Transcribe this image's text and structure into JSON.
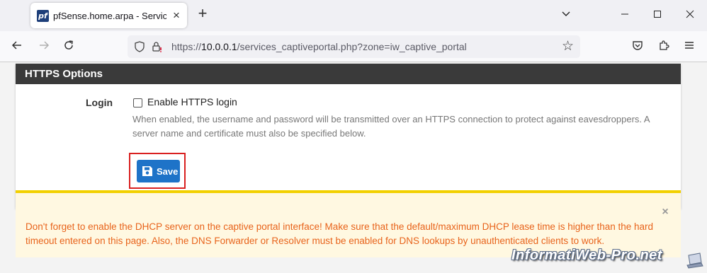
{
  "browser": {
    "tab_title": "pfSense.home.arpa - Services: Captive Portal",
    "favicon_text": "pf",
    "url_prefix": "https://",
    "url_host": "10.0.0.1",
    "url_path": "/services_captiveportal.php?zone=iw_captive_portal"
  },
  "panel": {
    "title": "HTTPS Options",
    "login_label": "Login",
    "checkbox_label": "Enable HTTPS login",
    "checkbox_checked": false,
    "help_text": "When enabled, the username and password will be transmitted over an HTTPS connection to protect against eavesdroppers. A server name and certificate must also be specified below."
  },
  "save_label": "Save",
  "alert": {
    "close_glyph": "×",
    "text": "Don't forget to enable the DHCP server on the captive portal interface! Make sure that the default/maximum DHCP lease time is higher than the hard timeout entered on this page. Also, the DNS Forwarder or Resolver must be enabled for DNS lookups by unauthenticated clients to work."
  },
  "watermark": "InformatiWeb-Pro.net",
  "colors": {
    "panel_header": "#3a3a3a",
    "save_button": "#1e73c8",
    "highlight_border": "#d92020",
    "alert_border": "#f2d000",
    "alert_text": "#e8631b"
  }
}
